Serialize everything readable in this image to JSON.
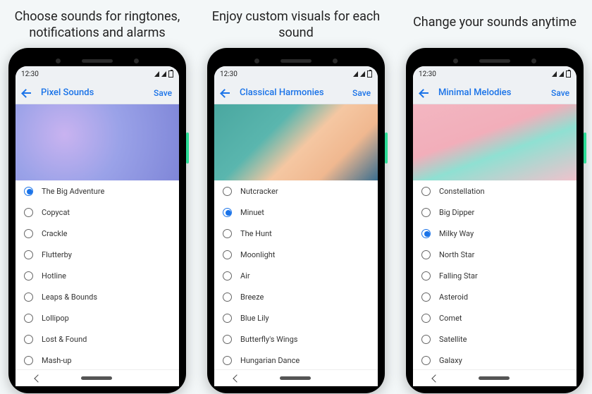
{
  "captions": [
    "Choose sounds for ringtones, notifications and alarms",
    "Enjoy custom visuals for each sound",
    "Change your sounds anytime"
  ],
  "statusbar": {
    "time": "12:30"
  },
  "appbar": {
    "save": "Save"
  },
  "phones": [
    {
      "title": "Pixel Sounds",
      "selected": 0,
      "items": [
        "The Big Adventure",
        "Copycat",
        "Crackle",
        "Flutterby",
        "Hotline",
        "Leaps & Bounds",
        "Lollipop",
        "Lost & Found",
        "Mash-up"
      ]
    },
    {
      "title": "Classical Harmonies",
      "selected": 1,
      "items": [
        "Nutcracker",
        "Minuet",
        "The Hunt",
        "Moonlight",
        "Air",
        "Breeze",
        "Blue Lily",
        "Butterfly's Wings",
        "Hungarian Dance"
      ]
    },
    {
      "title": "Minimal Melodies",
      "selected": 2,
      "items": [
        "Constellation",
        "Big Dipper",
        "Milky Way",
        "North Star",
        "Falling Star",
        "Asteroid",
        "Comet",
        "Satellite",
        "Galaxy"
      ]
    }
  ]
}
